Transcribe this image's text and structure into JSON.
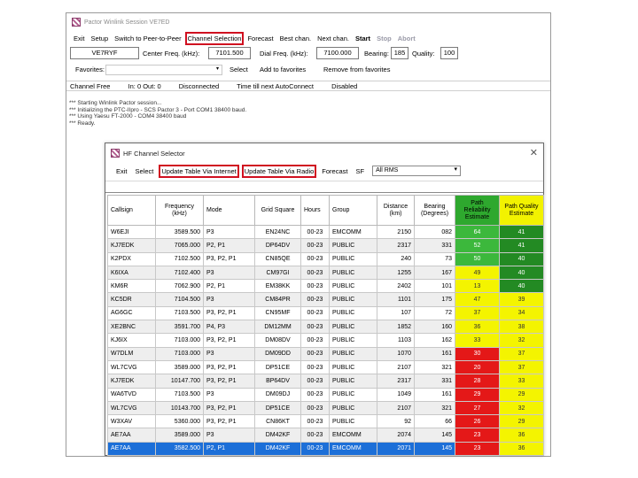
{
  "main": {
    "title": "Pactor Winlink Session VE7ED",
    "menu": [
      "Exit",
      "Setup",
      "Switch to Peer-to-Peer",
      "Channel Selection",
      "Forecast",
      "Best chan.",
      "Next chan.",
      "Start",
      "Stop",
      "Abort"
    ],
    "callsign": "VE7RYF",
    "center_freq_label": "Center Freq. (kHz):",
    "center_freq": "7101.500",
    "dial_freq_label": "Dial Freq. (kHz):",
    "dial_freq": "7100.000",
    "bearing_label": "Bearing:",
    "bearing": "185",
    "quality_label": "Quality:",
    "quality": "100",
    "favorites_label": "Favorites:",
    "select_label": "Select",
    "add_fav": "Add to favorites",
    "remove_fav": "Remove from favorites",
    "status": {
      "free": "Channel Free",
      "inout": "In: 0  Out: 0",
      "state": "Disconnected",
      "time": "Time till next AutoConnect",
      "auto": "Disabled"
    },
    "log": [
      "*** Starting Winlink Pactor session...",
      "*** Initializing the PTC-IIpro - SCS Pactor 3 - Port COM1 38400 baud.",
      "*** Using Yaesu FT-2000 - COM4 38400 baud",
      "*** Ready."
    ]
  },
  "dialog": {
    "title": "HF Channel Selector",
    "menu": [
      "Exit",
      "Select",
      "Update Table Via Internet",
      "Update Table Via Radio",
      "Forecast"
    ],
    "sf_label": "SF",
    "filter_value": "All RMS",
    "columns": [
      "Callsign",
      "Frequency (kHz)",
      "Mode",
      "Grid Square",
      "Hours",
      "Group",
      "Distance (km)",
      "Bearing (Degrees)",
      "Path Reliability Estimate",
      "Path Quality Estimate"
    ],
    "rows": [
      [
        "W6EJI",
        "3589.500",
        "P3",
        "EN24NC",
        "00-23",
        "EMCOMM",
        "2150",
        "082",
        "64",
        "41"
      ],
      [
        "KJ7EDK",
        "7065.000",
        "P2, P1",
        "DP64DV",
        "00-23",
        "PUBLIC",
        "2317",
        "331",
        "52",
        "41"
      ],
      [
        "K2PDX",
        "7102.500",
        "P3, P2, P1",
        "CN85QE",
        "00-23",
        "PUBLIC",
        "240",
        "73",
        "50",
        "40"
      ],
      [
        "K6IXA",
        "7102.400",
        "P3",
        "CM97GI",
        "00-23",
        "PUBLIC",
        "1255",
        "167",
        "49",
        "40"
      ],
      [
        "KM6R",
        "7062.900",
        "P2, P1",
        "EM38KK",
        "00-23",
        "PUBLIC",
        "2402",
        "101",
        "13",
        "40"
      ],
      [
        "KC5DR",
        "7104.500",
        "P3",
        "CM84PR",
        "00-23",
        "PUBLIC",
        "1101",
        "175",
        "47",
        "39"
      ],
      [
        "AG6GC",
        "7103.500",
        "P3, P2, P1",
        "CN95MF",
        "00-23",
        "PUBLIC",
        "107",
        "72",
        "37",
        "34"
      ],
      [
        "XE2BNC",
        "3591.700",
        "P4, P3",
        "DM12MM",
        "00-23",
        "PUBLIC",
        "1852",
        "160",
        "36",
        "38"
      ],
      [
        "KJ6IX",
        "7103.000",
        "P3, P2, P1",
        "DM08DV",
        "00-23",
        "PUBLIC",
        "1103",
        "162",
        "33",
        "32"
      ],
      [
        "W7DLM",
        "7103.000",
        "P3",
        "DM09DD",
        "00-23",
        "PUBLIC",
        "1070",
        "161",
        "30",
        "37"
      ],
      [
        "WL7CVG",
        "3589.000",
        "P3, P2, P1",
        "DP51CE",
        "00-23",
        "PUBLIC",
        "2107",
        "321",
        "20",
        "37"
      ],
      [
        "KJ7EDK",
        "10147.700",
        "P3, P2, P1",
        "BP64DV",
        "00-23",
        "PUBLIC",
        "2317",
        "331",
        "28",
        "33"
      ],
      [
        "WA6TVD",
        "7103.500",
        "P3",
        "DM09DJ",
        "00-23",
        "PUBLIC",
        "1049",
        "161",
        "29",
        "29"
      ],
      [
        "WL7CVG",
        "10143.700",
        "P3, P2, P1",
        "DP51CE",
        "00-23",
        "PUBLIC",
        "2107",
        "321",
        "27",
        "32"
      ],
      [
        "W3XAV",
        "5360.000",
        "P3, P2, P1",
        "CN86KT",
        "00-23",
        "PUBLIC",
        "92",
        "66",
        "26",
        "29"
      ],
      [
        "AE7AA",
        "3589.000",
        "P3",
        "DM42KF",
        "00-23",
        "EMCOMM",
        "2074",
        "145",
        "23",
        "36"
      ],
      [
        "AE7AA",
        "3582.500",
        "P2, P1",
        "DM42KF",
        "00-23",
        "EMCOMM",
        "2071",
        "145",
        "23",
        "36"
      ]
    ],
    "reliability_colors": [
      "g",
      "g",
      "g",
      "y",
      "y",
      "y",
      "y",
      "y",
      "y",
      "r",
      "r",
      "r",
      "r",
      "r",
      "r",
      "r",
      "r"
    ],
    "quality_colors": [
      "dg",
      "dg",
      "dg",
      "dg",
      "dg",
      "y",
      "y",
      "y",
      "y",
      "y",
      "y",
      "y",
      "y",
      "y",
      "y",
      "y",
      "y"
    ]
  },
  "colors": {
    "highlight_red": "#d01020",
    "selected_row": "#1c6fd8"
  }
}
